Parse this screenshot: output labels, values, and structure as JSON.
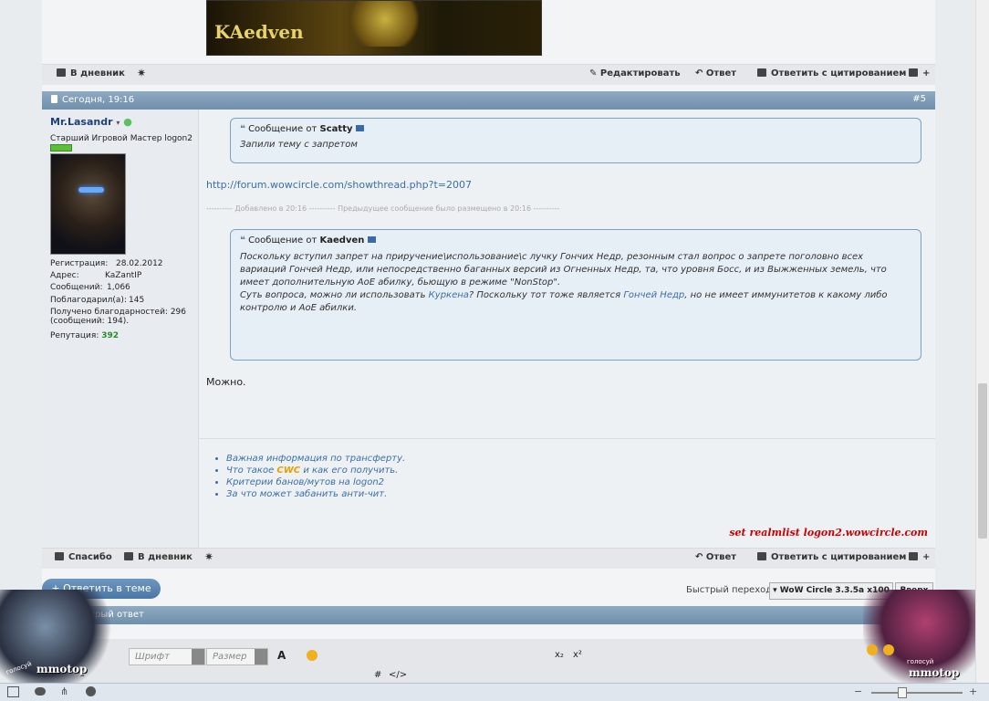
{
  "top_actions": {
    "diary": "В дневник",
    "edit": "Редактировать",
    "reply": "Ответ",
    "reply_quote": "Ответить с цитированием"
  },
  "post": {
    "date": "Сегодня, 19:16",
    "number": "#5"
  },
  "user": {
    "name": "Mr.Lasandr",
    "title": "Старший Игровой Мастер logon2",
    "avatar_caption": "<GM> Las",
    "reg_label": "Регистрация:",
    "reg_value": "28.02.2012",
    "addr_label": "Адрес:",
    "addr_value": "KaZantIP",
    "msgs_label": "Сообщений:",
    "msgs_value": "1,066",
    "thanked_label": "Поблагодарил(а):",
    "thanked_value": "145",
    "received": "Получено благодарностей: 296 (сообщений: 194).",
    "rep_label": "Репутация:",
    "rep_value": "392"
  },
  "quote1": {
    "prefix": "Сообщение от",
    "author": "Scatty",
    "text": "Запили тему с запретом"
  },
  "link_url": "http://forum.wowcircle.com/showthread.php?t=2007",
  "merge_note": "---------- Добавлено в 20:16 ---------- Предыдущее сообщение было размещено в 20:16 ----------",
  "quote2": {
    "prefix": "Сообщение от",
    "author": "Kaedven",
    "p1": "Поскольку вступил запрет на приручение\\использование\\с лучку Гончих Недр, резонным стал вопрос о запрете поголовно всех вариаций Гончей Недр, или непосредственно баганных версий из Огненных Недр, та, что уровня Босс, и из Выжженных земель, что имеет дополнительную АоЕ абилку, бьющую в режиме \"NonStop\".",
    "p2_a": "Суть вопроса, можно ли использовать ",
    "p2_link1": "Куркена",
    "p2_b": "? Поскольку тот тоже является ",
    "p2_link2": "Гончей Недр",
    "p2_c": ", но не имеет иммунитетов к какому либо контролю и АоЕ абилки."
  },
  "answer": "Можно.",
  "sig_links": [
    {
      "a": "Важная информация по трансферту.",
      "b": "",
      "c": ""
    },
    {
      "a": "Что такое ",
      "b": "CWC",
      "c": " и как его получить."
    },
    {
      "a": "Критерии банов/мутов на logon2",
      "b": "",
      "c": ""
    },
    {
      "a": "За что может забанить анти-чит.",
      "b": "",
      "c": ""
    }
  ],
  "sig_realm": "set realmlist logon2.wowcircle.com",
  "bottom_actions": {
    "thanks": "Спасибо",
    "diary": "В дневник",
    "reply": "Ответ",
    "reply_quote": "Ответить с цитированием"
  },
  "reply_button": "+ Ответить в теме",
  "quick_jump_label": "Быстрый переход",
  "quick_jump_value": "WoW Circle 3.3.5a x100",
  "up_button": "Вверх",
  "quick_reply": "Быстрый ответ",
  "editor": {
    "font": "Шрифт",
    "size": "Размер"
  },
  "banner_left": "mmotop",
  "banner_right": "mmotop",
  "banner_text": "голосуй",
  "colors": {
    "header": "#7793ae",
    "link": "#3b6fa8",
    "realm": "#cc0000",
    "rep": "#2a8a2a"
  }
}
